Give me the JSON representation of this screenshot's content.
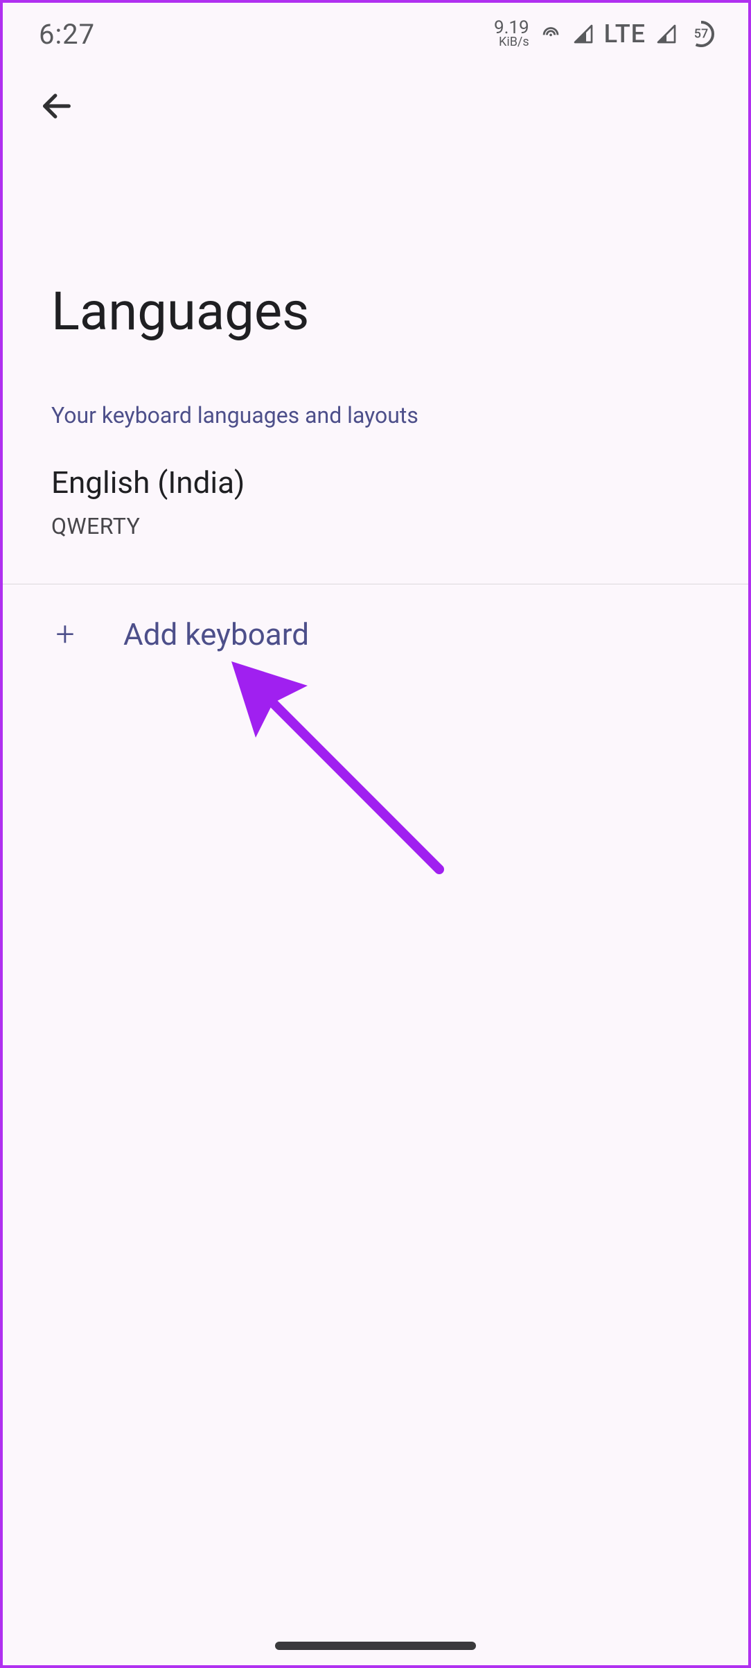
{
  "status_bar": {
    "time": "6:27",
    "data_rate_value": "9.19",
    "data_rate_unit": "KiB/s",
    "network_label": "LTE",
    "battery_percent": "57"
  },
  "page": {
    "title": "Languages",
    "section_heading": "Your keyboard languages and layouts"
  },
  "languages": [
    {
      "name": "English (India)",
      "layout": "QWERTY"
    }
  ],
  "add_keyboard": {
    "label": "Add keyboard"
  }
}
